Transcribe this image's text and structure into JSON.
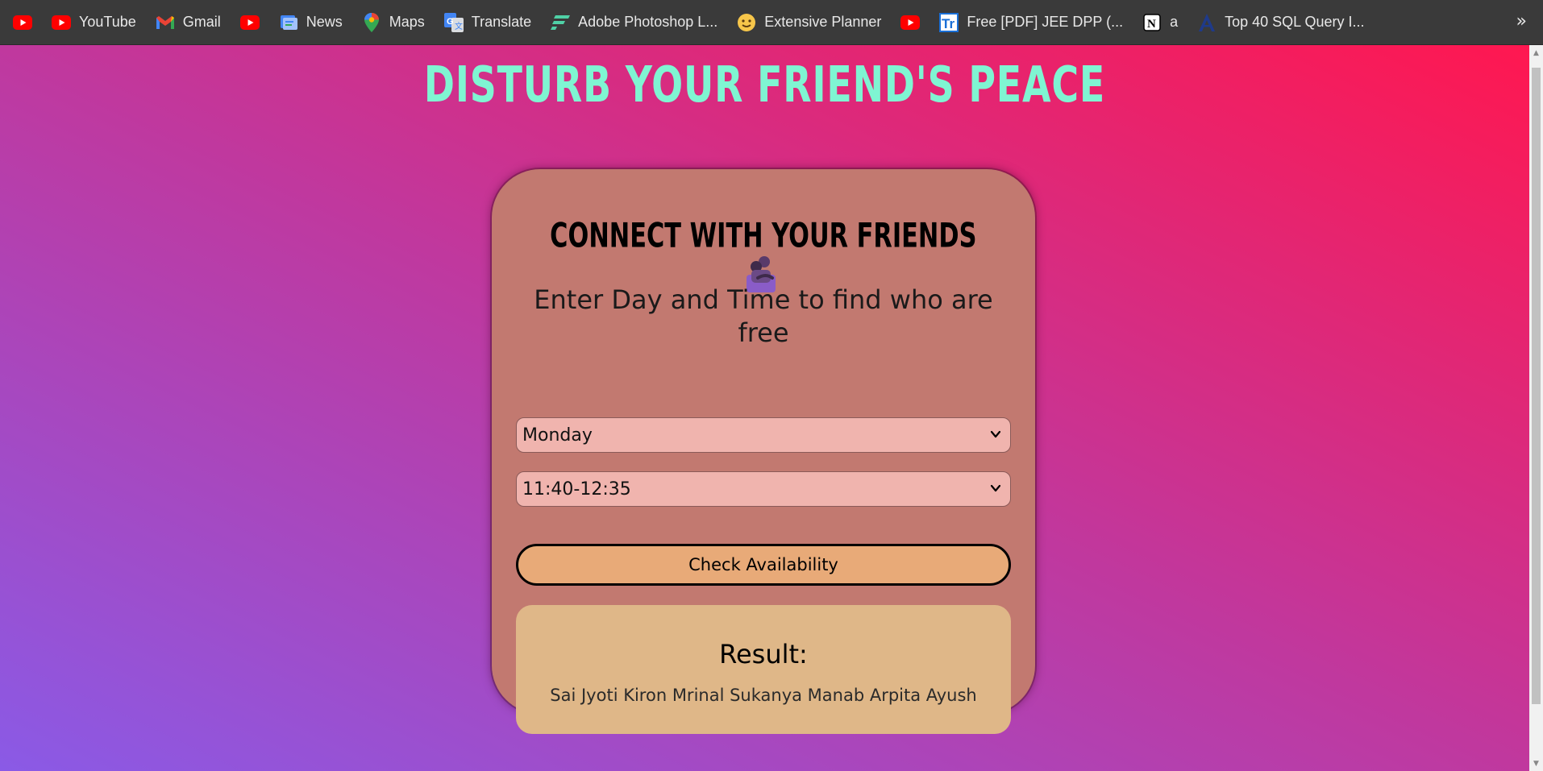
{
  "bookmarks": [
    {
      "label": "",
      "icon": "youtube-icon"
    },
    {
      "label": "YouTube",
      "icon": "youtube-icon"
    },
    {
      "label": "Gmail",
      "icon": "gmail-icon"
    },
    {
      "label": "",
      "icon": "youtube-icon"
    },
    {
      "label": "News",
      "icon": "news-icon"
    },
    {
      "label": "Maps",
      "icon": "maps-icon"
    },
    {
      "label": "Translate",
      "icon": "translate-icon"
    },
    {
      "label": "Adobe Photoshop L...",
      "icon": "photoshop-icon"
    },
    {
      "label": "Extensive Planner",
      "icon": "smiley-icon"
    },
    {
      "label": "",
      "icon": "youtube-icon"
    },
    {
      "label": "Free [PDF] JEE DPP (...",
      "icon": "pdf-site-icon"
    },
    {
      "label": "a",
      "icon": "notion-icon"
    },
    {
      "label": "Top 40 SQL Query I...",
      "icon": "sql-site-icon"
    }
  ],
  "bookmarks_more": "»",
  "page": {
    "title": "Disturb your friend's Peace"
  },
  "card": {
    "heading": "Connect with your friends",
    "heading_icon": "people-hugging-icon",
    "instruction": "Enter Day and Time to find who are free",
    "day_select": {
      "value": "Monday"
    },
    "time_select": {
      "value": "11:40-12:35"
    },
    "check_button": "Check Availability",
    "result": {
      "title": "Result:",
      "names": "Sai Jyoti Kiron Mrinal Sukanya Manab Arpita Ayush"
    }
  },
  "colors": {
    "bookmarks_bar": "#3a3a3a",
    "gradient_start": "#8a5ae6",
    "gradient_mid": "#c0389e",
    "gradient_end": "#ff1750",
    "title": "#7ff5d2",
    "card": "#c27970",
    "select": "#f0b4ae",
    "button": "#e8aa78",
    "result": "#dfb788"
  }
}
